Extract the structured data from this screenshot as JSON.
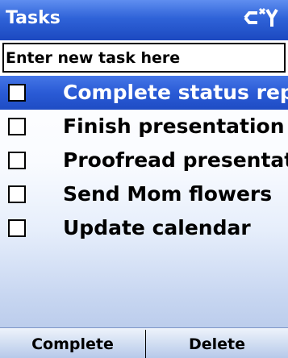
{
  "title": "Tasks",
  "header": {
    "connectivity_icon": "connectivity-icon"
  },
  "new_task": {
    "placeholder": "Enter new task here"
  },
  "tasks": [
    {
      "label": "Complete status rep",
      "checked": false,
      "selected": true
    },
    {
      "label": "Finish presentation",
      "checked": false,
      "selected": false
    },
    {
      "label": "Proofread presentati",
      "checked": false,
      "selected": false
    },
    {
      "label": "Send Mom flowers",
      "checked": false,
      "selected": false
    },
    {
      "label": "Update calendar",
      "checked": false,
      "selected": false
    }
  ],
  "softkeys": {
    "left": "Complete",
    "right": "Delete"
  },
  "colors": {
    "title_bar": "#2f63d8",
    "selection": "#2a5bd6",
    "selection_text": "#ffffff"
  }
}
